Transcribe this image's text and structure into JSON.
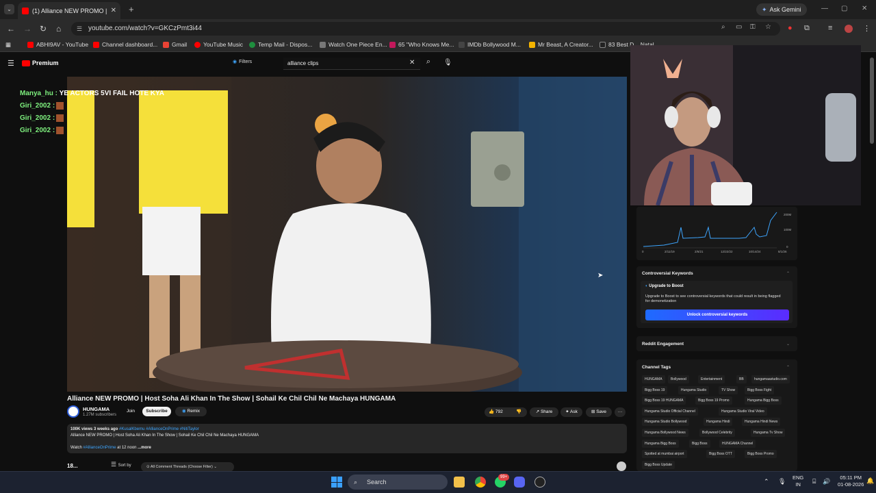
{
  "browser": {
    "tab_title": "(1) Alliance NEW PROMO | Host",
    "tab_close": "✕",
    "new_tab": "+",
    "ask_gemini": "Ask Gemini",
    "url": "youtube.com/watch?v=GKCzPmt3i44",
    "bookmarks": [
      {
        "label": "ABHI9AV - YouTube",
        "color": "#ff0000"
      },
      {
        "label": "Channel dashboard...",
        "color": "#ff0000"
      },
      {
        "label": "Gmail",
        "color": "#ea4335"
      },
      {
        "label": "YouTube Music",
        "color": "#ff0000"
      },
      {
        "label": "Temp Mail - Dispos...",
        "color": "#1e8e3e"
      },
      {
        "label": "Watch One Piece En...",
        "color": "#777777"
      },
      {
        "label": "65 \"Who Knows Me...",
        "color": "#c2185b"
      },
      {
        "label": "IMDb Bollywood M...",
        "color": "#444444"
      },
      {
        "label": "Mr Beast, A Creator...",
        "color": "#f4b400"
      },
      {
        "label": "83 Best D... Natal",
        "color": "#222222"
      }
    ],
    "all_bookmarks": "All Bookmarks"
  },
  "youtube": {
    "logo": "Premium",
    "filters": "Filters",
    "search_value": "alliance clips",
    "video_title": "Alliance NEW PROMO | Host Soha Ali Khan In The Show | Sohail Ke Chil Chil Ne Machaya HUNGAMA",
    "channel_name": "HUNGAMA",
    "subscribers": "1.27M subscribers",
    "join": "Join",
    "subscribe": "Subscribe",
    "remix": "Remix",
    "likes": "792",
    "share": "Share",
    "ask": "Ask",
    "save": "Save",
    "more": "···",
    "description": {
      "meta": "100K views  3 weeks ago",
      "tags": "#KusalKbemu #AllianceOnPrime #NitiTaylor",
      "line1": "Alliance NEW PROMO | Host Soha Ali Khan In The Show | Sohail Ke Chil Chil Ne Machaya HUNGAMA",
      "watch_prefix": "Watch ",
      "watch_tag": "#AllianceOnPrime",
      "watch_suffix": " at 12 noon",
      "more": " ...more"
    },
    "comments_count": "18...",
    "sort_by": "Sort by",
    "comment_filter": "All Comment Threads (Choose Filter)"
  },
  "chat": [
    {
      "user": "Manya_hu :",
      "message": " YE ACTORS 5VI FAIL HOTE KYA"
    },
    {
      "user": "Giri_2002 :",
      "message": ""
    },
    {
      "user": "Giri_2002 :",
      "message": ""
    },
    {
      "user": "Giri_2002 :",
      "message": ""
    }
  ],
  "panel": {
    "chart_ticks_y": [
      "200M",
      "100M",
      "0"
    ],
    "chart_ticks_x": [
      "0",
      "2/11/19",
      "2/6/21",
      "12/22/22",
      "10/14/24",
      "8/1/26"
    ],
    "controversial_title": "Controversial Keywords",
    "upgrade_title": "Upgrade to Boost",
    "upgrade_text": "Upgrade to Boost to see controversial keywords that could result in being flagged for demonetization",
    "unlock_button": "Unlock controversial keywords",
    "reddit_title": "Reddit Engagement",
    "tags_title": "Channel Tags",
    "tags": [
      [
        "HUNGAMA",
        "Bollywood",
        "Entertainment",
        "BB",
        "hungamaastudio.com"
      ],
      [
        "Bigg Boss 19",
        "Hungama Studio",
        "TV Show",
        "Bigg Boss Fight"
      ],
      [
        "Bigg Boss 19 HUNGAMA",
        "Bigg Boss 19 Promo",
        "Hungama Bigg Boss"
      ],
      [
        "Hungama Studio Official Channel",
        "Hungama Studio Viral Video"
      ],
      [
        "Hungama Studio Bollywood",
        "Hungama Hindi",
        "Hungama Hindi News"
      ],
      [
        "Hungama Bollywood News",
        "Bollywood Celebrity",
        "Hungama Tv Show"
      ],
      [
        "Hungama Bigg Boss",
        "Bigg Boss",
        "HUNGAMA Channel"
      ],
      [
        "Spotted at mumbai airport",
        "Bigg Boss OTT",
        "Bigg Boss Promo"
      ],
      [
        "Bigg Boss Update"
      ]
    ]
  },
  "taskbar": {
    "search": "Search",
    "badge": "99+",
    "lang1": "ENG",
    "lang2": "IN",
    "time": "05:11 PM",
    "date": "01-08-2026"
  }
}
